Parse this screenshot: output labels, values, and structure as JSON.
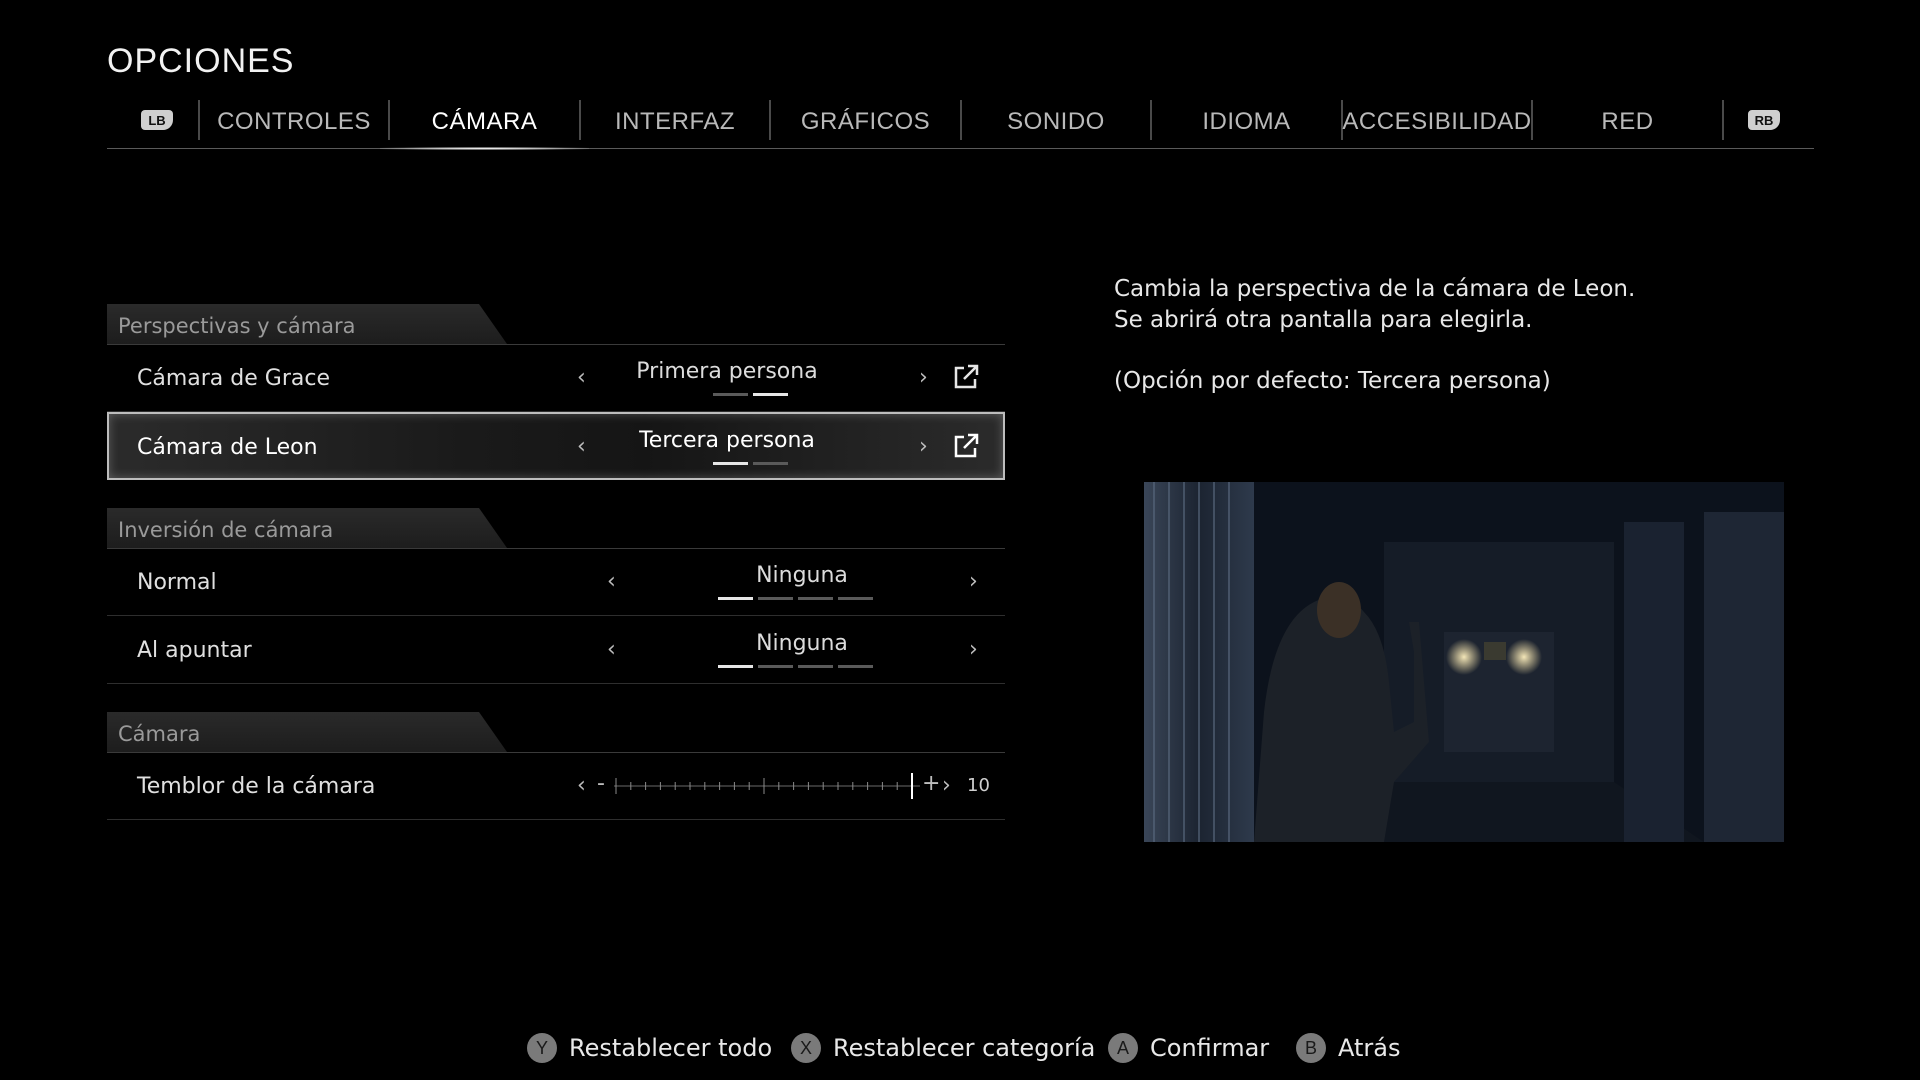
{
  "header": {
    "title": "OPCIONES"
  },
  "tabs": {
    "lb": "LB",
    "rb": "RB",
    "items": [
      {
        "label": "CONTROLES"
      },
      {
        "label": "CÁMARA",
        "active": true
      },
      {
        "label": "INTERFAZ"
      },
      {
        "label": "GRÁFICOS"
      },
      {
        "label": "SONIDO"
      },
      {
        "label": "IDIOMA"
      },
      {
        "label": "ACCESIBILIDAD"
      },
      {
        "label": "RED"
      }
    ]
  },
  "sections": {
    "perspectives": {
      "title": "Perspectivas y cámara",
      "grace": {
        "label": "Cámara de Grace",
        "value": "Primera persona",
        "options_count": 2,
        "selected_index": 1,
        "prev": "‹",
        "next": "›",
        "icon": "external-link-icon"
      },
      "leon": {
        "label": "Cámara de Leon",
        "value": "Tercera persona",
        "options_count": 2,
        "selected_index": 0,
        "prev": "‹",
        "next": "›",
        "icon": "external-link-icon",
        "selected": true
      }
    },
    "inversion": {
      "title": "Inversión de cámara",
      "normal": {
        "label": "Normal",
        "value": "Ninguna",
        "options_count": 4,
        "selected_index": 0,
        "prev": "‹",
        "next": "›"
      },
      "apuntar": {
        "label": "Al apuntar",
        "value": "Ninguna",
        "options_count": 4,
        "selected_index": 0,
        "prev": "‹",
        "next": "›"
      }
    },
    "camara": {
      "title": "Cámara",
      "shake": {
        "label": "Temblor de la cámara",
        "value": "10",
        "min": 0,
        "max": 10,
        "minus": "-",
        "plus": "+",
        "prev": "‹",
        "next": "›"
      }
    }
  },
  "description": {
    "line1": "Cambia la perspectiva de la cámara de Leon.",
    "line2": "Se abrirá otra pantalla para elegirla.",
    "default_note": "(Opción por defecto: Tercera persona)"
  },
  "footer": {
    "reset_all": {
      "key": "Y",
      "label": "Restablecer todo"
    },
    "reset_category": {
      "key": "X",
      "label": "Restablecer categoría"
    },
    "confirm": {
      "key": "A",
      "label": "Confirmar"
    },
    "back": {
      "key": "B",
      "label": "Atrás"
    }
  },
  "colors": {
    "background": "#000000",
    "text": "#e6e6e6",
    "accent": "#ffffff",
    "muted": "#9a9a9a"
  }
}
